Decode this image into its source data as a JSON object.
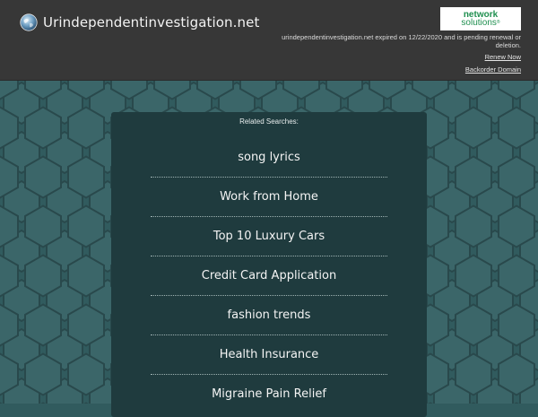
{
  "header": {
    "domain": "Urindependentinvestigation.net",
    "brand_line1": "network",
    "brand_line2": "solutions",
    "brand_mark": "®",
    "expired_message": "urindependentinvestigation.net expired on 12/22/2020 and is pending renewal or deletion.",
    "renew_label": "Renew Now",
    "backorder_label": "Backorder Domain"
  },
  "main": {
    "related_label": "Related Searches:",
    "searches": [
      "song lyrics",
      "Work from Home",
      "Top 10 Luxury Cars",
      "Credit Card Application",
      "fashion trends",
      "Health Insurance",
      "Migraine Pain Relief"
    ]
  },
  "colors": {
    "topbar": "#373737",
    "background": "#315b5e",
    "panel": "#1f3b3e",
    "brand_green": "#1f8f4f"
  },
  "icons": {
    "site": "globe-icon"
  }
}
